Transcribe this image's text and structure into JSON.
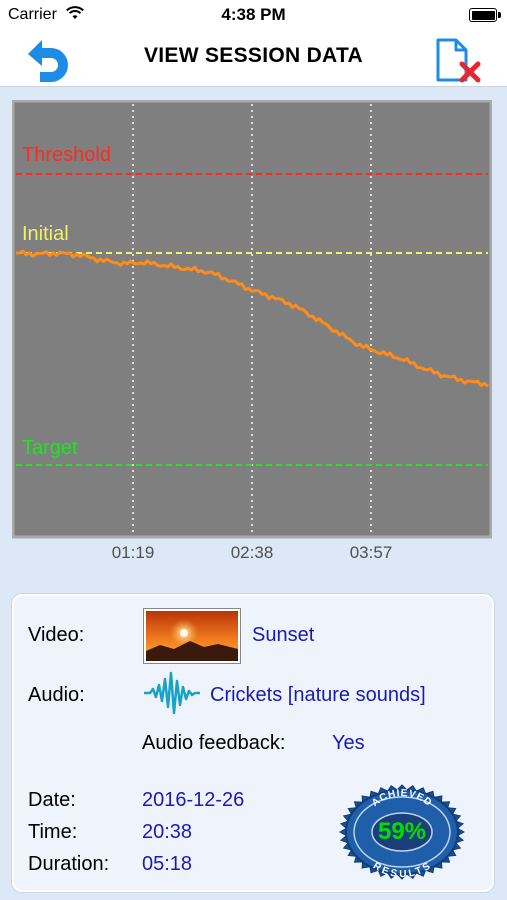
{
  "status_bar": {
    "carrier": "Carrier",
    "time": "4:38 PM"
  },
  "nav": {
    "title": "VIEW SESSION DATA"
  },
  "chart_data": {
    "type": "line",
    "x_ticks": [
      "01:19",
      "02:38",
      "03:57"
    ],
    "reference_lines": [
      {
        "name": "Threshold",
        "color": "#ff2a1c",
        "style": "dashed"
      },
      {
        "name": "Initial",
        "color": "#f1f164",
        "style": "dashed"
      },
      {
        "name": "Target",
        "color": "#1ee51e",
        "style": "dashed"
      }
    ],
    "series": [
      {
        "color": "#ff8c1a",
        "values": [
          0.0,
          -0.1,
          0.0,
          -0.2,
          -0.7,
          -1.0,
          -0.9,
          -1.2,
          -1.5,
          -1.8,
          -2.6,
          -3.5,
          -4.2,
          -5.0,
          -6.2,
          -7.5,
          -8.7,
          -9.4,
          -10.0,
          -10.9,
          -11.6,
          -12.1,
          -12.4
        ]
      }
    ],
    "grid": true,
    "background": "#7f7f7f"
  },
  "session": {
    "video_label": "Video:",
    "video_value": "Sunset",
    "audio_label": "Audio:",
    "audio_value": "Crickets [nature sounds]",
    "feedback_label": "Audio feedback:",
    "feedback_value": "Yes",
    "date_label": "Date:",
    "date_value": "2016-12-26",
    "time_label": "Time:",
    "time_value": "20:38",
    "duration_label": "Duration:",
    "duration_value": "05:18"
  },
  "badge": {
    "top_text": "ACHIEVED",
    "bottom_text": "RESULTS",
    "value": "59%"
  },
  "colors": {
    "accent": "#1e8ce6",
    "value_text": "#1a1ab8",
    "line": "#ff8c1a"
  }
}
